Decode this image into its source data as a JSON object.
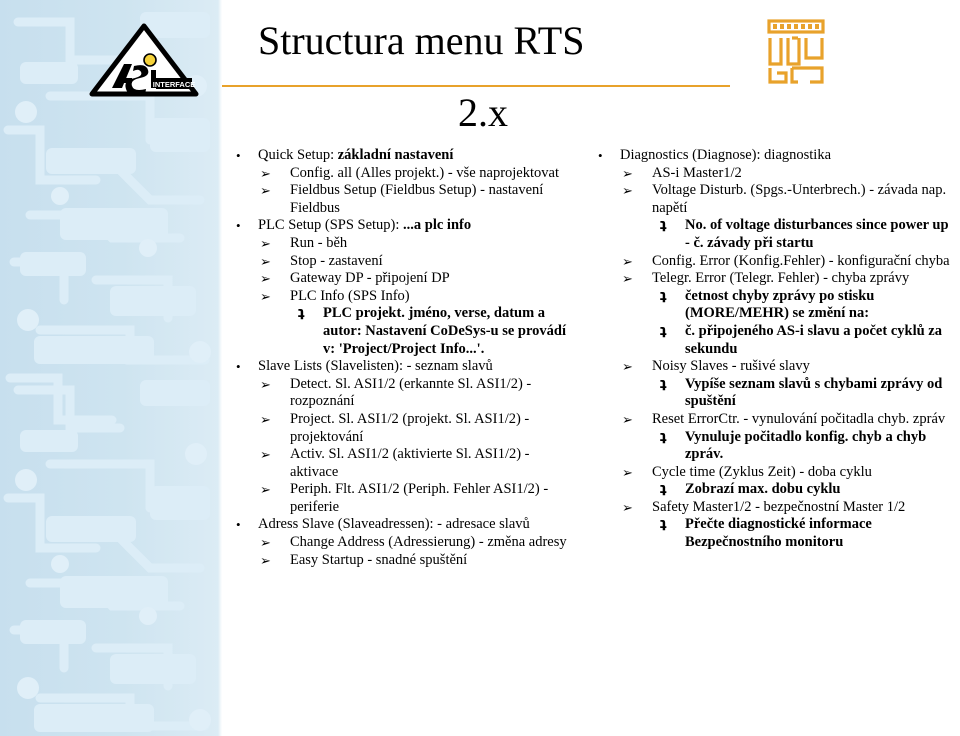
{
  "slide": {
    "title_line1": "Structura menu RTS",
    "title_line2": "2.x",
    "accent_color": "#e8a22b",
    "sidebar_color": "#cfe3ef"
  },
  "logos": {
    "asi_logo_letters": "AS",
    "asi_logo_subtext": "INTERFACE",
    "corner_mark_label": "electronic"
  },
  "bullets": {
    "level1": "•",
    "level2": "➢",
    "level3": "ʇ"
  },
  "left_column": [
    {
      "level": 1,
      "text": "Quick Setup: ",
      "bold_tail": "základní nastavení"
    },
    {
      "level": 2,
      "text": "Config. all (Alles projekt.) - vše naprojektovat"
    },
    {
      "level": 2,
      "text": "Fieldbus Setup (Fieldbus Setup) - nastavení Fieldbus"
    },
    {
      "level": 1,
      "text": "PLC Setup (SPS Setup): ",
      "bold_tail": "...a plc info"
    },
    {
      "level": 2,
      "text": "Run - běh"
    },
    {
      "level": 2,
      "text": "Stop - zastavení"
    },
    {
      "level": 2,
      "text": "Gateway DP - připojení DP"
    },
    {
      "level": 2,
      "text": "PLC Info (SPS Info)"
    },
    {
      "level": 3,
      "text": "PLC projekt. jméno,  verse, datum a autor: Nastavení CoDeSys-u se provádí v:  'Project/Project Info...'."
    },
    {
      "level": 1,
      "text": "Slave Lists (Slavelisten): - seznam slavů"
    },
    {
      "level": 2,
      "text": "Detect. Sl. ASI1/2 (erkannte Sl. ASI1/2) - rozpoznání"
    },
    {
      "level": 2,
      "text": "Project. Sl. ASI1/2 (projekt. Sl. ASI1/2) - projektování"
    },
    {
      "level": 2,
      "text": "Activ. Sl. ASI1/2 (aktivierte Sl. ASI1/2) - aktivace"
    },
    {
      "level": 2,
      "text": "Periph. Flt. ASI1/2 (Periph. Fehler ASI1/2) - periferie"
    },
    {
      "level": 1,
      "text": "Adress Slave (Slaveadressen): - adresace slavů"
    },
    {
      "level": 2,
      "text": "Change Address (Adressierung) - změna adresy"
    },
    {
      "level": 2,
      "text": "Easy Startup - snadné spuštění"
    }
  ],
  "right_column": [
    {
      "level": 1,
      "text": "Diagnostics (Diagnose): diagnostika"
    },
    {
      "level": 2,
      "text": "AS-i Master1/2"
    },
    {
      "level": 2,
      "text": "Voltage Disturb. (Spgs.-Unterbrech.) - závada nap. napětí"
    },
    {
      "level": 3,
      "text": "No. of voltage disturbances since power up - č. závady při startu"
    },
    {
      "level": 2,
      "text": "Config. Error (Konfig.Fehler) - konfigurační chyba"
    },
    {
      "level": 2,
      "text": "Telegr. Error (Telegr. Fehler) - chyba zprávy"
    },
    {
      "level": 3,
      "text": "četnost chyby zprávy  po stisku (MORE/MEHR) se změní na:"
    },
    {
      "level": 3,
      "text": "č. připojeného AS-i slavu a počet cyklů za sekundu"
    },
    {
      "level": 2,
      "text": "Noisy Slaves - rušivé slavy"
    },
    {
      "level": 3,
      "text": "Vypíše seznam slavů s chybami zprávy od spuštění"
    },
    {
      "level": 2,
      "text": "Reset ErrorCtr. - vynulování počitadla chyb. zpráv"
    },
    {
      "level": 3,
      "text": "Vynuluje počitadlo konfig. chyb a chyb zpráv."
    },
    {
      "level": 2,
      "text": "Cycle time (Zyklus Zeit) - doba cyklu"
    },
    {
      "level": 3,
      "text": "Zobrazí max. dobu cyklu"
    },
    {
      "level": 2,
      "text": "Safety Master1/2 - bezpečnostní Master 1/2"
    },
    {
      "level": 3,
      "text": "Přečte diagnostické informace Bezpečnostního monitoru"
    }
  ]
}
